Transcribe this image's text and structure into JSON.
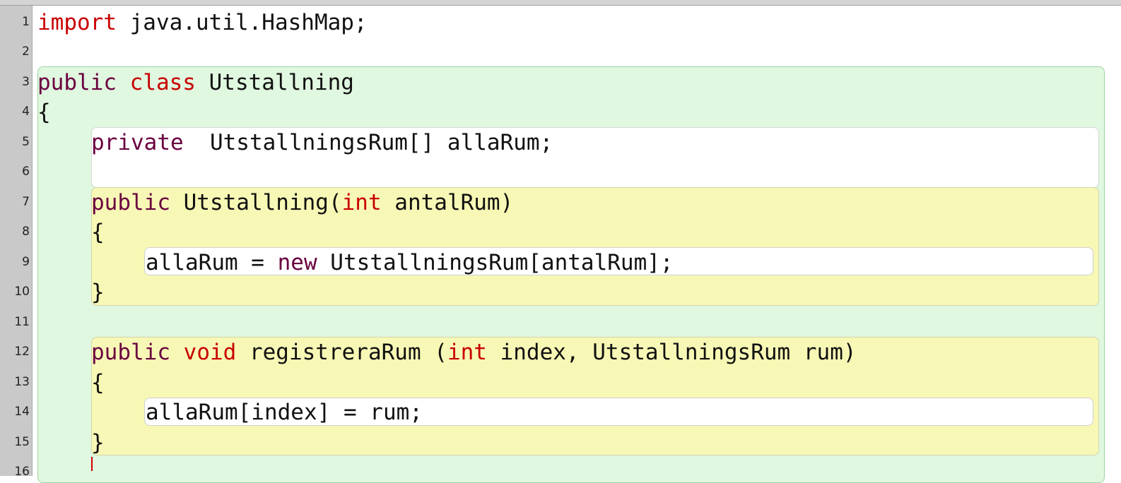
{
  "editor": {
    "line_numbers": [
      "1",
      "2",
      "3",
      "4",
      "5",
      "6",
      "7",
      "8",
      "9",
      "10",
      "11",
      "12",
      "13",
      "14",
      "15",
      "16"
    ],
    "lines": {
      "l1": {
        "kw": "import",
        "rest": " java.util.HashMap;"
      },
      "l3": {
        "kw1": "public",
        "sp": " ",
        "kw2": "class",
        "rest": " Utstallning"
      },
      "l4": {
        "text": "{"
      },
      "l5": {
        "kw": "private",
        "rest": "  UtstallningsRum[] allaRum;"
      },
      "l7": {
        "kw": "public",
        "mid": " Utstallning(",
        "kw2": "int",
        "rest": " antalRum)"
      },
      "l8": {
        "text": "{"
      },
      "l9": {
        "pre": "allaRum = ",
        "kw": "new",
        "rest": " UtstallningsRum[antalRum];"
      },
      "l10": {
        "text": "}"
      },
      "l12": {
        "kw": "public",
        "sp": " ",
        "kw2": "void",
        "mid": " registreraRum (",
        "kw3": "int",
        "rest": " index, UtstallningsRum rum)"
      },
      "l13": {
        "text": "{"
      },
      "l14": {
        "text": "allaRum[index] = rum;"
      },
      "l15": {
        "text": "}"
      }
    }
  }
}
